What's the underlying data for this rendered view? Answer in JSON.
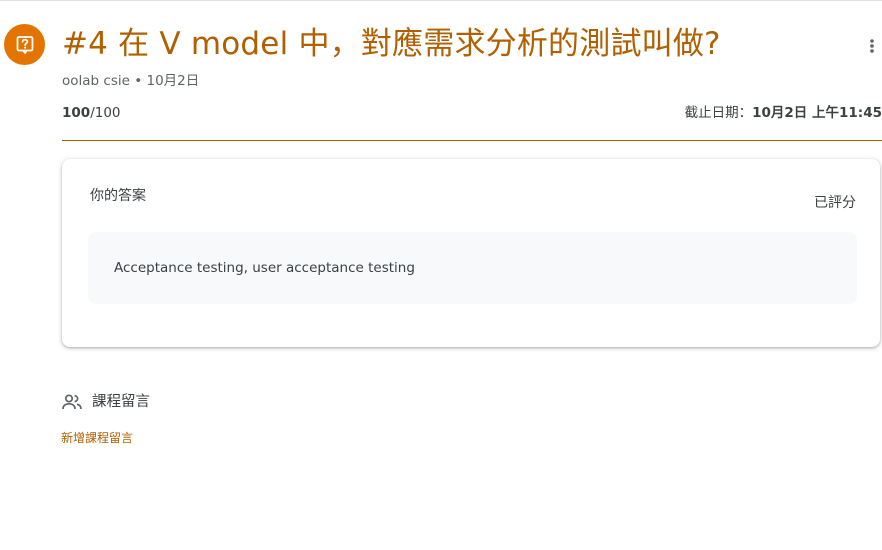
{
  "assignment": {
    "title": "#4 在 V model 中，對應需求分析的測試叫做?",
    "author": "oolab csie",
    "separator": "•",
    "posted_date": "10月2日",
    "score_earned": "100",
    "score_total": "/100",
    "due_label": "截止日期：",
    "due_date": "10月2日 上午",
    "due_time": "11:45"
  },
  "answer_card": {
    "title": "你的答案",
    "status": "已評分",
    "answer": "Acceptance testing, user acceptance testing"
  },
  "comments": {
    "header": "課程留言",
    "add_link": "新增課程留言"
  },
  "icons": {
    "badge": "question-answer-icon",
    "more": "more-vert-icon",
    "people": "people-icon"
  },
  "colors": {
    "accent": "#e37400",
    "accent_text": "#b06000",
    "card_fill": "#f8f9fa"
  }
}
